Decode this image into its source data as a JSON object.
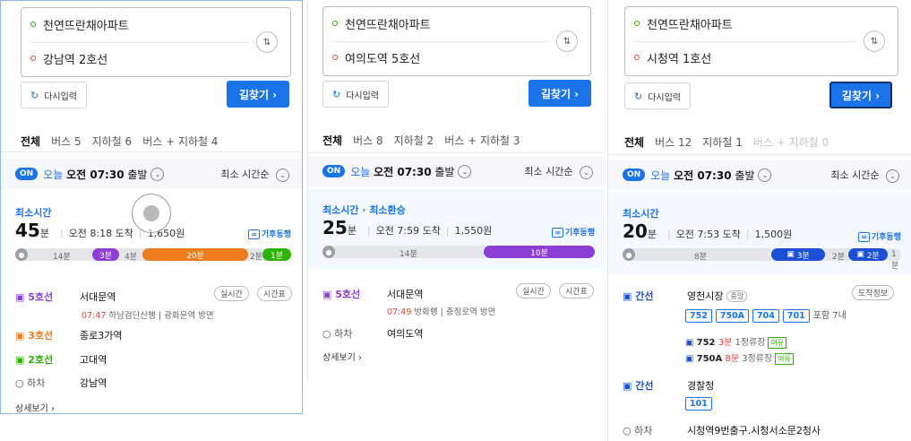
{
  "colors": {
    "accent": "#1a73e8",
    "line5": "#8b3fd6",
    "line3": "#ef7c1c",
    "line2": "#2db400",
    "red": "#e54242"
  },
  "panels": [
    {
      "origin": "천연뜨란채아파트",
      "destination": "강남역 2호선",
      "reset": "다시입력",
      "find": "길찾기 ›",
      "tabs": [
        "전체",
        "버스 5",
        "지하철 6",
        "버스 + 지하철 4"
      ],
      "on": "ON",
      "depart_pre": "오늘 ",
      "depart_bold": "오전 07:30",
      "depart_post": " 출발",
      "sort": "최소 시간순",
      "section": "최소시간",
      "duration": "45",
      "duration_unit": "분",
      "arrival": "오전 8:18 도착",
      "fare": "1,650원",
      "weather": "기후동행",
      "bar": {
        "walk1": "14분",
        "seg1": "3분",
        "mid": "4분",
        "seg2": "20분",
        "end": "2분",
        "seg3": "1분"
      },
      "steps": [
        {
          "line": "5호선",
          "station": "서대문역",
          "sub_time": "07:47",
          "sub_text": "하남검단산행 | 광화문역 방면"
        },
        {
          "line": "3호선",
          "station": "종로3가역"
        },
        {
          "line": "2호선",
          "station": "고대역"
        },
        {
          "line": "하차",
          "station": "강남역"
        }
      ],
      "pills": [
        "실시간",
        "시간표"
      ],
      "more": "상세보기 ›"
    },
    {
      "origin": "천연뜨란채아파트",
      "destination": "여의도역 5호선",
      "reset": "다시입력",
      "find": "길찾기 ›",
      "tabs": [
        "전체",
        "버스 8",
        "지하철 2",
        "버스 + 지하철 3"
      ],
      "on": "ON",
      "depart_pre": "오늘 ",
      "depart_bold": "오전 07:30",
      "depart_post": " 출발",
      "sort": "최소 시간순",
      "section": "최소시간 · 최소환승",
      "duration": "25",
      "duration_unit": "분",
      "arrival": "오전 7:59 도착",
      "fare": "1,550원",
      "weather": "기후동행",
      "bar": {
        "walk1": "14분",
        "seg1": "10분"
      },
      "steps": [
        {
          "line": "5호선",
          "station": "서대문역",
          "sub_time": "07:49",
          "sub_text": "방화행 | 충정로역 방면"
        },
        {
          "line": "하차",
          "station": "여의도역"
        }
      ],
      "pills": [
        "실시간",
        "시간표"
      ],
      "more": "상세보기 ›"
    },
    {
      "origin": "천연뜨란채아파트",
      "destination": "시청역 1호선",
      "reset": "다시입력",
      "find": "길찾기 ›",
      "tabs": [
        "전체",
        "버스 12",
        "지하철 1",
        "버스 + 지하철 0"
      ],
      "on": "ON",
      "depart_pre": "오늘 ",
      "depart_bold": "오전 07:30",
      "depart_post": " 출발",
      "sort": "최소 시간순",
      "section": "최소시간",
      "duration": "20",
      "duration_unit": "분",
      "arrival": "오전 7:53 도착",
      "fare": "1,500원",
      "weather": "기후동행",
      "bar": {
        "walk1": "8분",
        "seg1": "3분",
        "mid": "2분",
        "seg2": "2분",
        "end": "1분"
      },
      "steps": [
        {
          "line": "간선",
          "station": "영천시장",
          "stop_tag": "중앙"
        },
        {
          "line": "간선",
          "station": "경찰청"
        },
        {
          "line": "하차",
          "station": "시청역9번출구.시청서소문2청사"
        }
      ],
      "chips": [
        "752",
        "750A",
        "704",
        "701"
      ],
      "chips_more": "포함 7내",
      "arrivals": [
        {
          "bus": "752",
          "min": "3분",
          "stops": "1정류장",
          "tag": "여유"
        },
        {
          "bus": "750A",
          "min": "8분",
          "stops": "3정류장",
          "tag": "여유"
        }
      ],
      "chip2": "101",
      "info_btn": "도착정보"
    }
  ]
}
